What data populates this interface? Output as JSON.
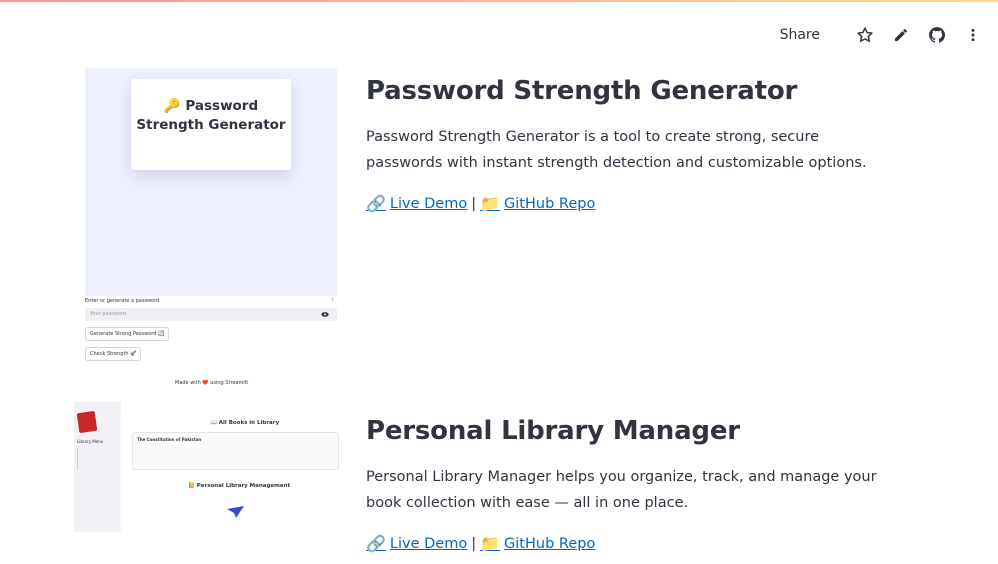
{
  "toolbar": {
    "share_label": "Share",
    "icons": [
      "star-icon",
      "pencil-icon",
      "github-icon",
      "more-vert-icon"
    ]
  },
  "projects": [
    {
      "title": "Password Strength Generator",
      "description": "Password Strength Generator is a tool to create strong, secure passwords with instant strength detection and customizable options.",
      "demo_label": "Live Demo",
      "repo_label": "GitHub Repo",
      "separator": "|",
      "thumbnail": {
        "card_title": "🔑 Password Strength Generator",
        "input_label": "Enter or generate a password",
        "input_placeholder": "Your password",
        "generate_button": "Generate Strong Password 🔄",
        "check_button": "Check Strength 🚀",
        "footer": "Made with ❤️ using Streamlit"
      }
    },
    {
      "title": "Personal Library Manager",
      "description": "Personal Library Manager helps you organize, track, and manage your book collection with ease — all in one place.",
      "demo_label": "Live Demo",
      "repo_label": "GitHub Repo",
      "separator": "|",
      "thumbnail": {
        "sidebar_title": "Library Menu",
        "header": "📖 All Books in Library",
        "book_title": "The Constitution of Pakistan",
        "section_title": "📔 Personal Library Management"
      }
    }
  ],
  "colors": {
    "link": "#0068c9",
    "text": "#31333f",
    "thumb_bg": "#eef0fd"
  }
}
